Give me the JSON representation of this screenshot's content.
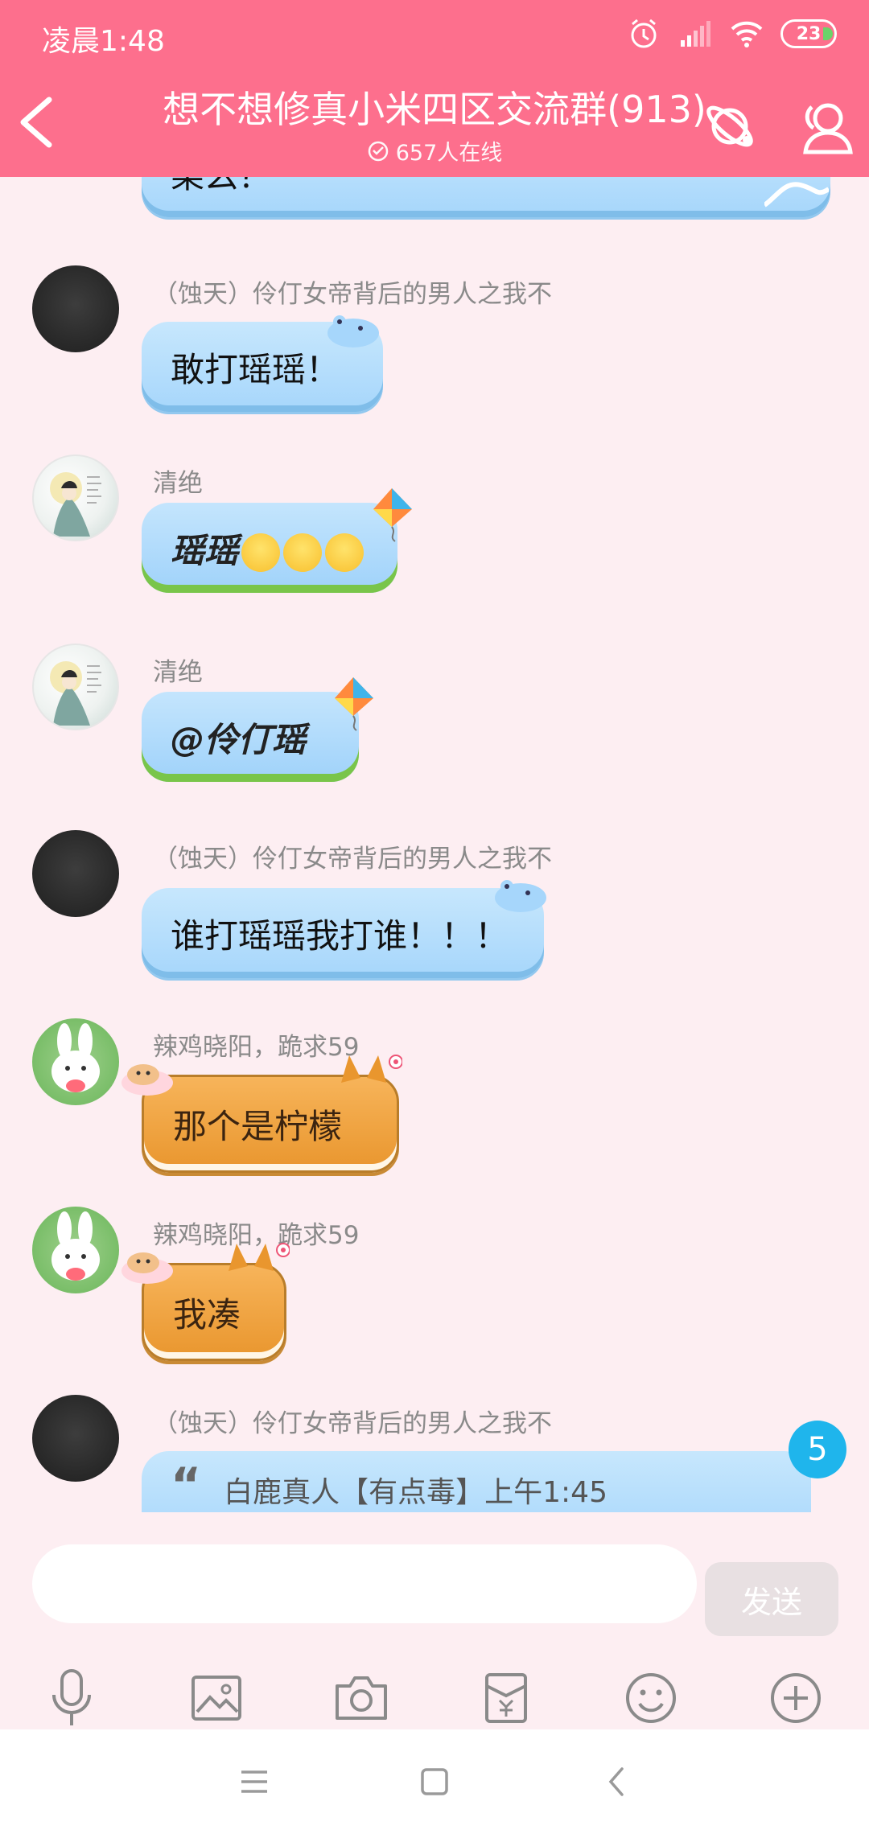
{
  "status_bar": {
    "time": "凌晨1:48",
    "battery": "23"
  },
  "header": {
    "title": "想不想修真小米四区交流群(913)",
    "online": "657人在线"
  },
  "messages": [
    {
      "partial_text": "桨么？"
    },
    {
      "sender": "（蚀天）伶仃女帝背后的男人之我不",
      "text": "敢打瑶瑶！"
    },
    {
      "sender": "清绝",
      "text": "瑶瑶"
    },
    {
      "sender": "清绝",
      "text": "@伶仃瑶"
    },
    {
      "sender": "（蚀天）伶仃女帝背后的男人之我不",
      "text": "谁打瑶瑶我打谁！！！"
    },
    {
      "sender": "辣鸡晓阳，跪求59",
      "text": "那个是柠檬"
    },
    {
      "sender": "辣鸡晓阳，跪求59",
      "text": "我凑"
    },
    {
      "sender": "（蚀天）伶仃女帝背后的男人之我不",
      "quote": "白鹿真人【有点毒】上午1:45"
    }
  ],
  "unread_badge": "5",
  "input": {
    "placeholder": "",
    "send_label": "发送"
  },
  "toolbar": [
    "microphone-icon",
    "image-icon",
    "camera-icon",
    "red-packet-icon",
    "emoji-icon",
    "plus-icon"
  ],
  "colors": {
    "header": "#fd6f8d",
    "background": "#fdeef2",
    "bubble_blue": "#a6d6fb",
    "bubble_orange": "#f0a544",
    "badge": "#1fb5ec"
  }
}
